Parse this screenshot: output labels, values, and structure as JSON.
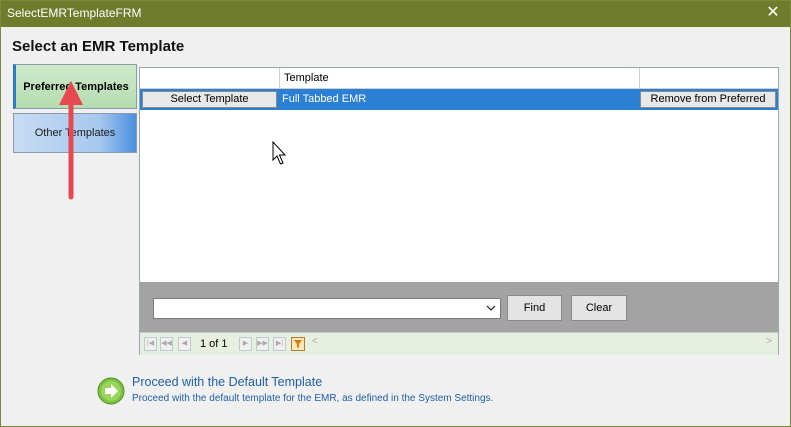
{
  "window": {
    "title": "SelectEMRTemplateFRM"
  },
  "heading": "Select an EMR Template",
  "tabs": [
    {
      "label": "Preferred Templates",
      "active": true
    },
    {
      "label": "Other Templates",
      "active": false
    }
  ],
  "grid": {
    "columns": [
      "",
      "Template",
      ""
    ],
    "rows": [
      {
        "action_label": "Select Template",
        "template": "Full Tabbed EMR",
        "remove_label": "Remove from Preferred",
        "selected": true
      }
    ]
  },
  "filter": {
    "value": "",
    "find_label": "Find",
    "clear_label": "Clear"
  },
  "pager": {
    "page_info": "1 of 1"
  },
  "proceed": {
    "title": "Proceed with the Default Template",
    "description": "Proceed with the default template for the EMR, as defined in the System Settings."
  },
  "colors": {
    "titlebar": "#6f7c2c",
    "selected_row": "#2b7fd4",
    "link": "#1f5fa8",
    "annotation_arrow": "#e8484f"
  },
  "icons": [
    "close-icon",
    "combo-arrow-icon",
    "filter-icon",
    "proceed-arrow-icon",
    "mouse-cursor-icon"
  ]
}
